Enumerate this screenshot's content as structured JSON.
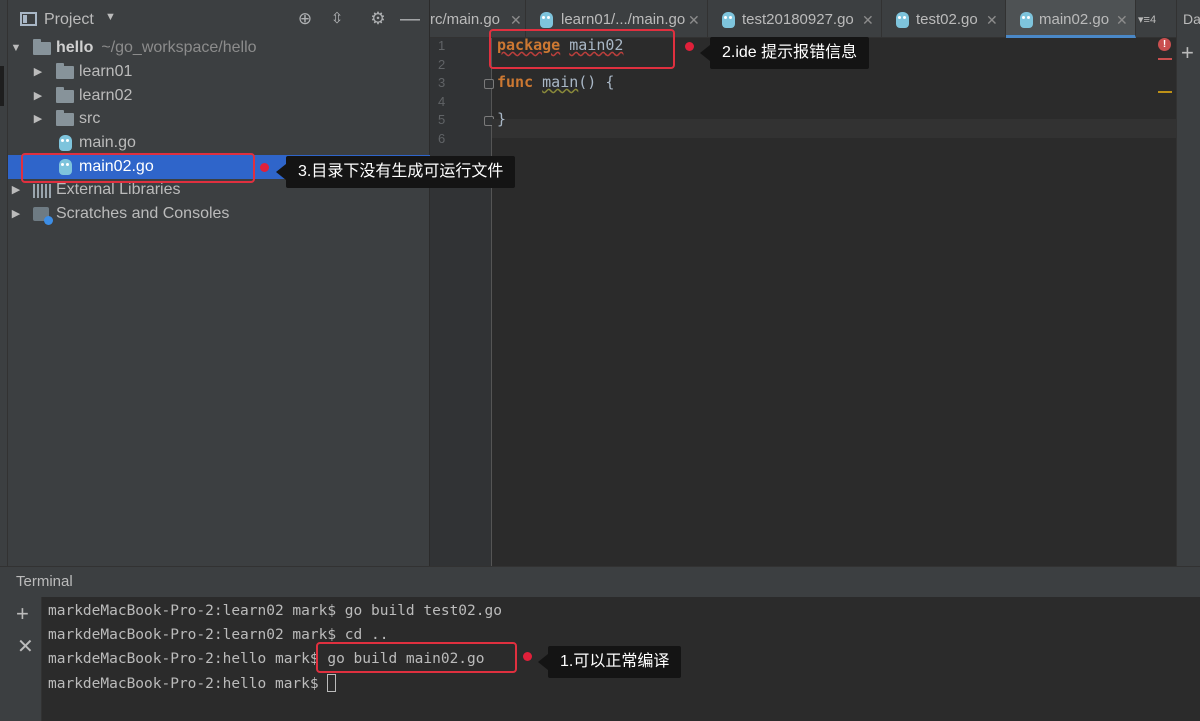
{
  "project": {
    "title": "Project",
    "root": {
      "name": "hello",
      "path": "~/go_workspace/hello"
    },
    "items": [
      {
        "label": "learn01"
      },
      {
        "label": "learn02"
      },
      {
        "label": "src"
      },
      {
        "label": "main.go"
      },
      {
        "label": "main02.go"
      },
      {
        "label": "External Libraries"
      },
      {
        "label": "Scratches and Consoles"
      }
    ]
  },
  "tabs": [
    {
      "label": "rc/main.go"
    },
    {
      "label": "learn01/.../main.go"
    },
    {
      "label": "test20180927.go"
    },
    {
      "label": "test02.go"
    },
    {
      "label": "main02.go"
    }
  ],
  "tab_overflow": "4",
  "right_edge_label": "Da",
  "editor": {
    "line_numbers": [
      "1",
      "2",
      "3",
      "4",
      "5",
      "6"
    ],
    "line1": {
      "kw": "package",
      "name": "main02"
    },
    "line3": {
      "kw": "func",
      "name": "main",
      "rest": "() {"
    },
    "line5": "}"
  },
  "terminal": {
    "title": "Terminal",
    "lines": [
      "markdeMacBook-Pro-2:learn02 mark$ go build test02.go",
      "markdeMacBook-Pro-2:learn02 mark$ cd ..",
      "markdeMacBook-Pro-2:hello mark$ go build main02.go",
      "markdeMacBook-Pro-2:hello mark$ "
    ]
  },
  "annotations": {
    "ide_error": "2.ide 提示报错信息",
    "no_executable": "3.目录下没有生成可运行文件",
    "compile_ok": "1.可以正常编译"
  }
}
